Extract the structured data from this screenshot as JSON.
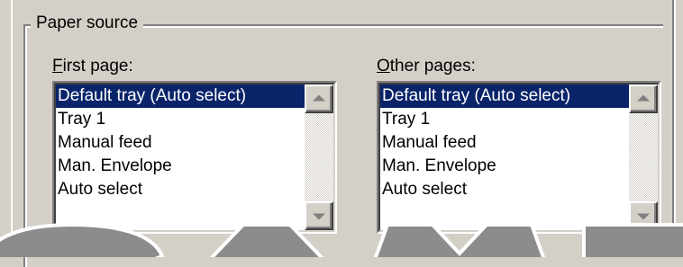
{
  "group": {
    "legend": "Paper source"
  },
  "first_page": {
    "label_accel": "F",
    "label_rest": "irst page:",
    "items": [
      "Default tray (Auto select)",
      "Tray 1",
      "Manual feed",
      "Man. Envelope",
      "Auto select"
    ],
    "selected_index": 0
  },
  "other_pages": {
    "label_accel": "O",
    "label_rest": "ther pages:",
    "items": [
      "Default tray (Auto select)",
      "Tray 1",
      "Manual feed",
      "Man. Envelope",
      "Auto select"
    ],
    "selected_index": 0
  },
  "colors": {
    "dialog_bg": "#d4d0c8",
    "selection_bg": "#0a246a",
    "selection_fg": "#ffffff",
    "watermark": "#8c8c8c"
  },
  "watermark": {
    "text": "SAMPLE",
    "icon": "watermark-logo"
  }
}
